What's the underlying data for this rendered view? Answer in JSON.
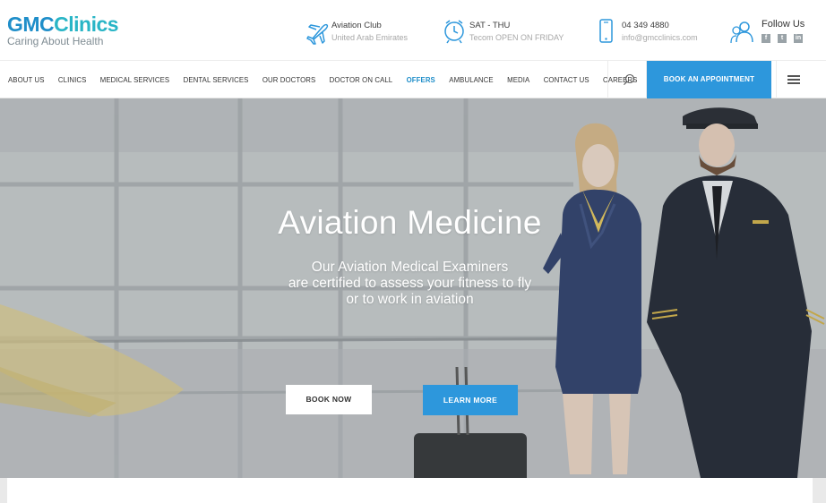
{
  "brand": {
    "logo_part1": "GMC",
    "logo_part2": "Clinics",
    "tagline": "Caring About Health"
  },
  "header": {
    "aviation": {
      "title": "Aviation Club",
      "subtitle": "United Arab Emirates",
      "icon": "airplane-icon"
    },
    "hours": {
      "title": "SAT - THU",
      "subtitle": "Tecom OPEN ON FRIDAY",
      "icon": "clock-icon"
    },
    "contact": {
      "title": "04 349 4880",
      "subtitle": "info@gmcclinics.com",
      "icon": "phone-icon"
    },
    "follow": {
      "title": "Follow Us",
      "icon": "people-icon",
      "social": [
        "f",
        "t",
        "in"
      ]
    }
  },
  "nav": {
    "items": [
      {
        "label": "ABOUT US"
      },
      {
        "label": "CLINICS"
      },
      {
        "label": "MEDICAL SERVICES"
      },
      {
        "label": "DENTAL SERVICES"
      },
      {
        "label": "OUR DOCTORS"
      },
      {
        "label": "DOCTOR ON CALL"
      },
      {
        "label": "OFFERS"
      },
      {
        "label": "AMBULANCE"
      },
      {
        "label": "MEDIA"
      },
      {
        "label": "CONTACT US"
      },
      {
        "label": "CAREERS"
      }
    ],
    "active_item": "OFFERS",
    "book_label": "BOOK AN APPOINTMENT"
  },
  "hero": {
    "title": "Aviation Medicine",
    "subtitle_line1": "Our Aviation Medical Examiners",
    "subtitle_line2": "are certified to assess your fitness to fly",
    "subtitle_line3": "or to work in aviation",
    "book_now": "BOOK NOW",
    "learn_more": "LEARN MORE"
  },
  "colors": {
    "brand_blue": "#1f8ec9",
    "brand_teal": "#29b5c6",
    "accent_button": "#2d97dc"
  }
}
